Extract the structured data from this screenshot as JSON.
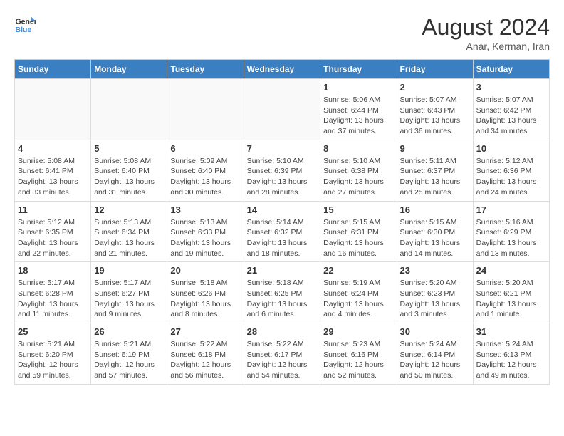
{
  "header": {
    "logo_line1": "General",
    "logo_line2": "Blue",
    "main_title": "August 2024",
    "subtitle": "Anar, Kerman, Iran"
  },
  "weekdays": [
    "Sunday",
    "Monday",
    "Tuesday",
    "Wednesday",
    "Thursday",
    "Friday",
    "Saturday"
  ],
  "weeks": [
    [
      {
        "day": "",
        "info": ""
      },
      {
        "day": "",
        "info": ""
      },
      {
        "day": "",
        "info": ""
      },
      {
        "day": "",
        "info": ""
      },
      {
        "day": "1",
        "info": "Sunrise: 5:06 AM\nSunset: 6:44 PM\nDaylight: 13 hours\nand 37 minutes."
      },
      {
        "day": "2",
        "info": "Sunrise: 5:07 AM\nSunset: 6:43 PM\nDaylight: 13 hours\nand 36 minutes."
      },
      {
        "day": "3",
        "info": "Sunrise: 5:07 AM\nSunset: 6:42 PM\nDaylight: 13 hours\nand 34 minutes."
      }
    ],
    [
      {
        "day": "4",
        "info": "Sunrise: 5:08 AM\nSunset: 6:41 PM\nDaylight: 13 hours\nand 33 minutes."
      },
      {
        "day": "5",
        "info": "Sunrise: 5:08 AM\nSunset: 6:40 PM\nDaylight: 13 hours\nand 31 minutes."
      },
      {
        "day": "6",
        "info": "Sunrise: 5:09 AM\nSunset: 6:40 PM\nDaylight: 13 hours\nand 30 minutes."
      },
      {
        "day": "7",
        "info": "Sunrise: 5:10 AM\nSunset: 6:39 PM\nDaylight: 13 hours\nand 28 minutes."
      },
      {
        "day": "8",
        "info": "Sunrise: 5:10 AM\nSunset: 6:38 PM\nDaylight: 13 hours\nand 27 minutes."
      },
      {
        "day": "9",
        "info": "Sunrise: 5:11 AM\nSunset: 6:37 PM\nDaylight: 13 hours\nand 25 minutes."
      },
      {
        "day": "10",
        "info": "Sunrise: 5:12 AM\nSunset: 6:36 PM\nDaylight: 13 hours\nand 24 minutes."
      }
    ],
    [
      {
        "day": "11",
        "info": "Sunrise: 5:12 AM\nSunset: 6:35 PM\nDaylight: 13 hours\nand 22 minutes."
      },
      {
        "day": "12",
        "info": "Sunrise: 5:13 AM\nSunset: 6:34 PM\nDaylight: 13 hours\nand 21 minutes."
      },
      {
        "day": "13",
        "info": "Sunrise: 5:13 AM\nSunset: 6:33 PM\nDaylight: 13 hours\nand 19 minutes."
      },
      {
        "day": "14",
        "info": "Sunrise: 5:14 AM\nSunset: 6:32 PM\nDaylight: 13 hours\nand 18 minutes."
      },
      {
        "day": "15",
        "info": "Sunrise: 5:15 AM\nSunset: 6:31 PM\nDaylight: 13 hours\nand 16 minutes."
      },
      {
        "day": "16",
        "info": "Sunrise: 5:15 AM\nSunset: 6:30 PM\nDaylight: 13 hours\nand 14 minutes."
      },
      {
        "day": "17",
        "info": "Sunrise: 5:16 AM\nSunset: 6:29 PM\nDaylight: 13 hours\nand 13 minutes."
      }
    ],
    [
      {
        "day": "18",
        "info": "Sunrise: 5:17 AM\nSunset: 6:28 PM\nDaylight: 13 hours\nand 11 minutes."
      },
      {
        "day": "19",
        "info": "Sunrise: 5:17 AM\nSunset: 6:27 PM\nDaylight: 13 hours\nand 9 minutes."
      },
      {
        "day": "20",
        "info": "Sunrise: 5:18 AM\nSunset: 6:26 PM\nDaylight: 13 hours\nand 8 minutes."
      },
      {
        "day": "21",
        "info": "Sunrise: 5:18 AM\nSunset: 6:25 PM\nDaylight: 13 hours\nand 6 minutes."
      },
      {
        "day": "22",
        "info": "Sunrise: 5:19 AM\nSunset: 6:24 PM\nDaylight: 13 hours\nand 4 minutes."
      },
      {
        "day": "23",
        "info": "Sunrise: 5:20 AM\nSunset: 6:23 PM\nDaylight: 13 hours\nand 3 minutes."
      },
      {
        "day": "24",
        "info": "Sunrise: 5:20 AM\nSunset: 6:21 PM\nDaylight: 13 hours\nand 1 minute."
      }
    ],
    [
      {
        "day": "25",
        "info": "Sunrise: 5:21 AM\nSunset: 6:20 PM\nDaylight: 12 hours\nand 59 minutes."
      },
      {
        "day": "26",
        "info": "Sunrise: 5:21 AM\nSunset: 6:19 PM\nDaylight: 12 hours\nand 57 minutes."
      },
      {
        "day": "27",
        "info": "Sunrise: 5:22 AM\nSunset: 6:18 PM\nDaylight: 12 hours\nand 56 minutes."
      },
      {
        "day": "28",
        "info": "Sunrise: 5:22 AM\nSunset: 6:17 PM\nDaylight: 12 hours\nand 54 minutes."
      },
      {
        "day": "29",
        "info": "Sunrise: 5:23 AM\nSunset: 6:16 PM\nDaylight: 12 hours\nand 52 minutes."
      },
      {
        "day": "30",
        "info": "Sunrise: 5:24 AM\nSunset: 6:14 PM\nDaylight: 12 hours\nand 50 minutes."
      },
      {
        "day": "31",
        "info": "Sunrise: 5:24 AM\nSunset: 6:13 PM\nDaylight: 12 hours\nand 49 minutes."
      }
    ]
  ]
}
